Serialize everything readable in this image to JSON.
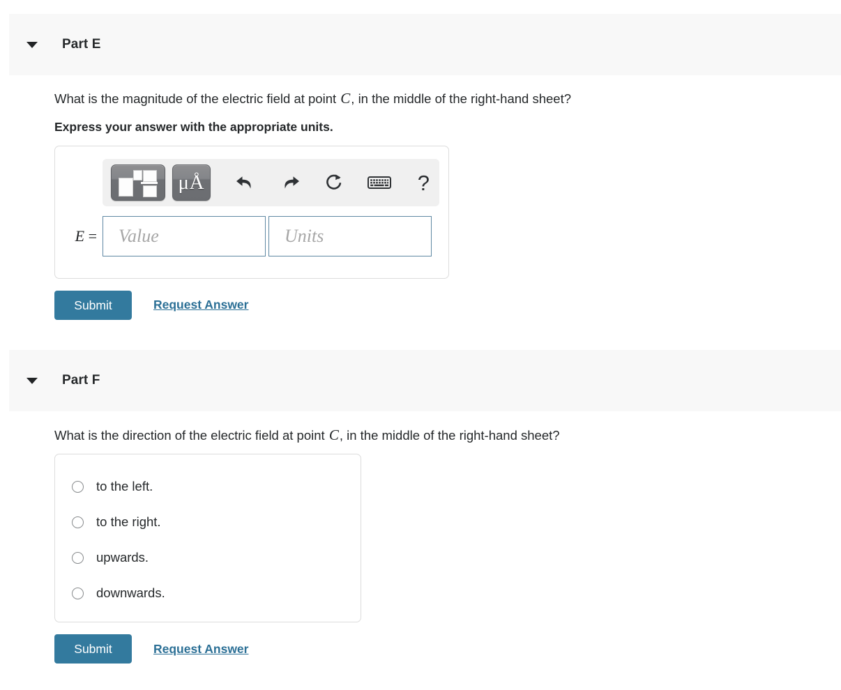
{
  "parts": [
    {
      "id": "part-e",
      "title": "Part E",
      "caret_icon": "chevron-down-icon",
      "question_prefix": "What is the magnitude of the electric field at point ",
      "question_var": "C",
      "question_suffix": ", in the middle of the right-hand sheet?",
      "instruction": "Express your answer with the appropriate units.",
      "answer": {
        "equation_label_var": "E",
        "equation_label_op": "=",
        "value_placeholder": "Value",
        "units_placeholder": "Units",
        "value_text": "",
        "units_text": "",
        "toolbar": [
          {
            "name": "math-templates-button",
            "icon": "math-template-icon",
            "label": ""
          },
          {
            "name": "units-button",
            "icon": "mu-angstrom-icon",
            "label": "μÅ"
          },
          {
            "name": "undo-button",
            "icon": "undo-arrow-icon",
            "label": ""
          },
          {
            "name": "redo-button",
            "icon": "redo-arrow-icon",
            "label": ""
          },
          {
            "name": "reset-button",
            "icon": "reset-circular-arrow-icon",
            "label": ""
          },
          {
            "name": "keyboard-button",
            "icon": "keyboard-icon",
            "label": ""
          },
          {
            "name": "help-button",
            "icon": "question-mark-icon",
            "label": "?"
          }
        ]
      },
      "submit_label": "Submit",
      "request_answer_label": "Request Answer"
    },
    {
      "id": "part-f",
      "title": "Part F",
      "caret_icon": "chevron-down-icon",
      "question_prefix": "What is the direction of the electric field at point ",
      "question_var": "C",
      "question_suffix": ", in the middle of the right-hand sheet?",
      "choices": [
        {
          "label": "to the left.",
          "selected": false
        },
        {
          "label": "to the right.",
          "selected": false
        },
        {
          "label": "upwards.",
          "selected": false
        },
        {
          "label": "downwards.",
          "selected": false
        }
      ],
      "submit_label": "Submit",
      "request_answer_label": "Request Answer"
    }
  ],
  "colors": {
    "header_band": "#f8f8f8",
    "submit_button": "#337a9e",
    "link": "#2c7096",
    "input_border": "#5f88a3",
    "box_border": "#dcdcdc",
    "text": "#25282a"
  }
}
